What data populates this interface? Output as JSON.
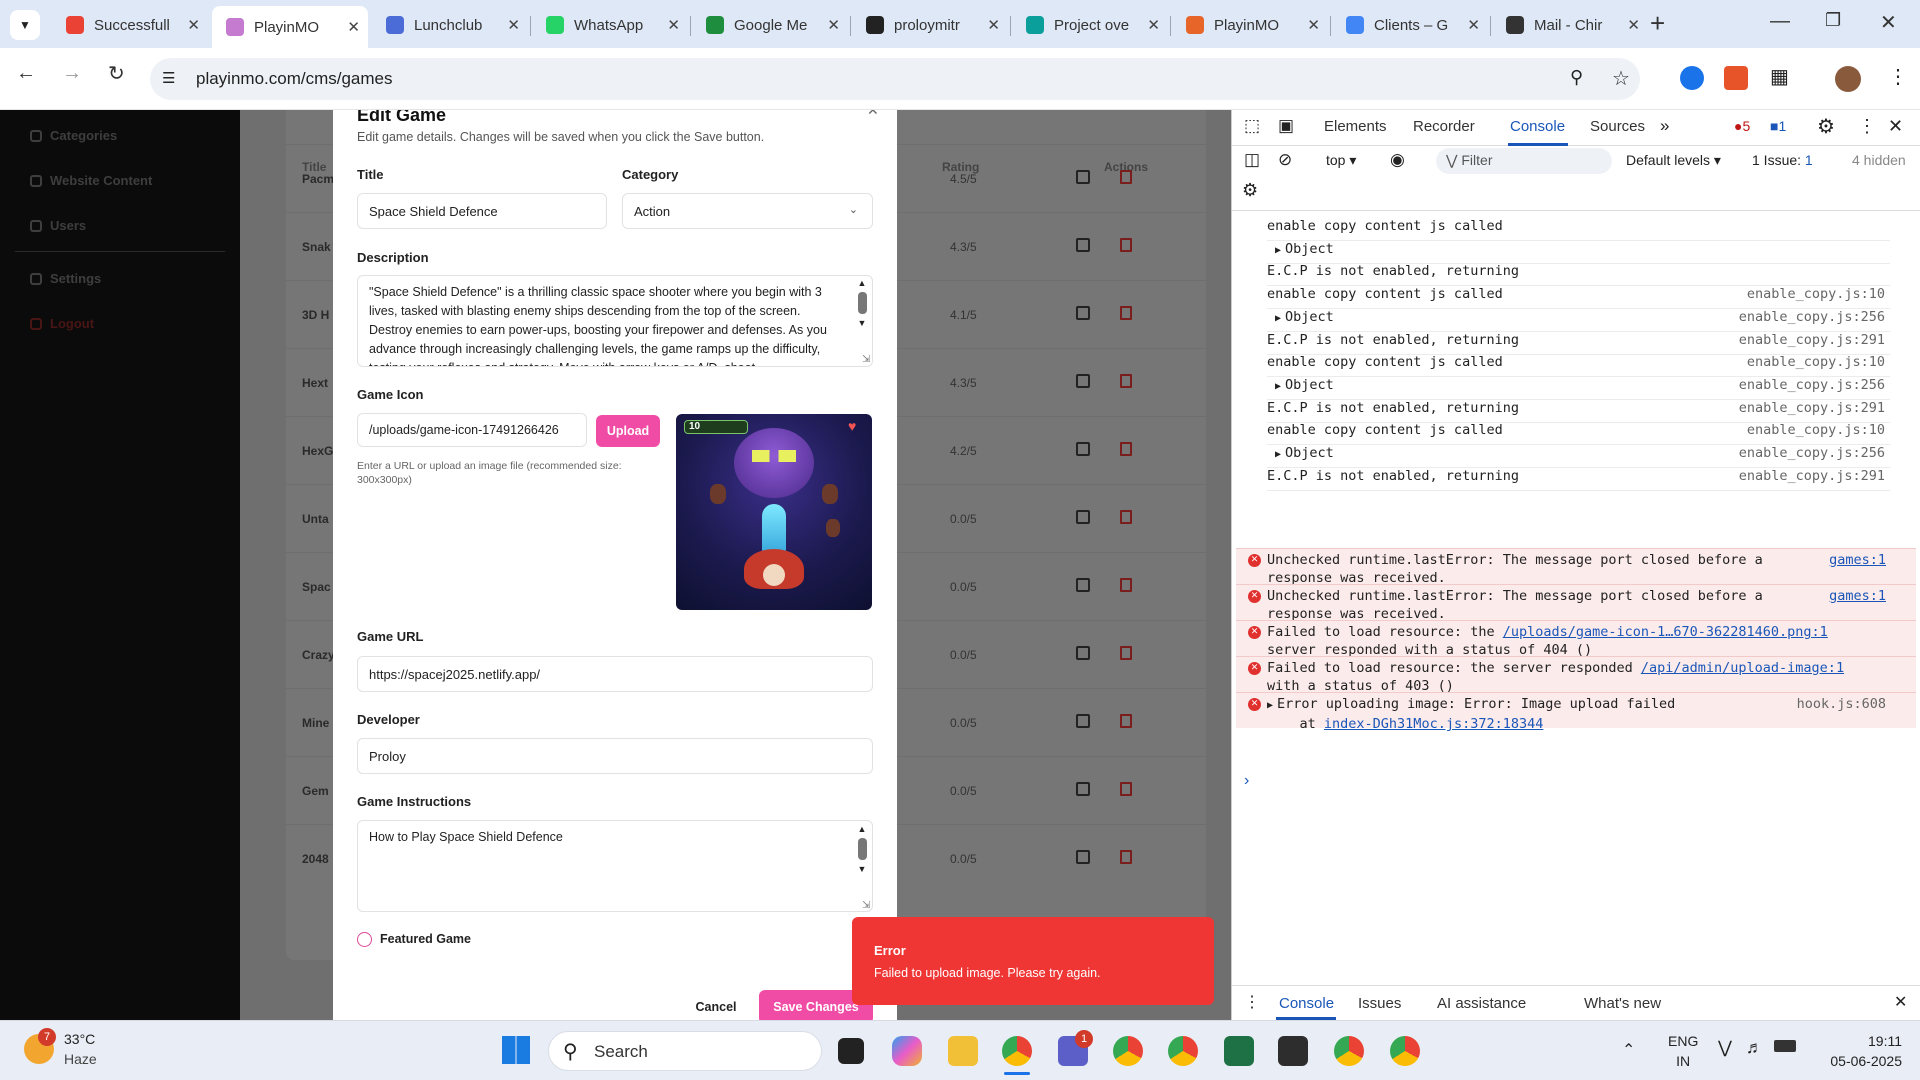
{
  "browser": {
    "tabs": [
      {
        "title": "Successfull",
        "color": "#ea4335"
      },
      {
        "title": "PlayinMO",
        "color": "#c47bd0",
        "active": true
      },
      {
        "title": "Lunchclub",
        "color": "#4b6bd6"
      },
      {
        "title": "WhatsApp",
        "color": "#25d366"
      },
      {
        "title": "Google Me",
        "color": "#1e8e3e"
      },
      {
        "title": "proloymitr",
        "color": "#222222"
      },
      {
        "title": "Project ove",
        "color": "#0a9f9a"
      },
      {
        "title": "PlayinMO",
        "color": "#e8652a"
      },
      {
        "title": "Clients – G",
        "color": "#4285f4"
      },
      {
        "title": "Mail - Chir",
        "color": "#333333"
      }
    ],
    "url": "playinmo.com/cms/games"
  },
  "sidebar": {
    "items": [
      {
        "label": "Categories"
      },
      {
        "label": "Website Content"
      },
      {
        "label": "Users"
      },
      {
        "label": "Settings"
      },
      {
        "label": "Logout"
      }
    ]
  },
  "table": {
    "headers": {
      "title": "Title",
      "rating": "Rating",
      "actions": "Actions"
    },
    "rows": [
      {
        "name": "Pacm",
        "rating": "4.5/5"
      },
      {
        "name": "Snak",
        "rating": "4.3/5"
      },
      {
        "name": "3D H",
        "rating": "4.1/5"
      },
      {
        "name": "Hext",
        "rating": "4.3/5"
      },
      {
        "name": "HexG",
        "rating": "4.2/5"
      },
      {
        "name": "Unta",
        "rating": "0.0/5"
      },
      {
        "name": "Spac",
        "rating": "0.0/5"
      },
      {
        "name": "Crazy",
        "rating": "0.0/5"
      },
      {
        "name": "Mine",
        "rating": "0.0/5"
      },
      {
        "name": "Gem",
        "rating": "0.0/5"
      },
      {
        "name": "2048",
        "rating": "0.0/5"
      }
    ]
  },
  "modal": {
    "title": "Edit Game",
    "subtitle": "Edit game details. Changes will be saved when you click the Save button.",
    "title_label": "Title",
    "title_value": "Space Shield Defence",
    "category_label": "Category",
    "category_value": "Action",
    "description_label": "Description",
    "description_value": "\"Space Shield Defence\" is a thrilling classic space shooter where you begin with 3 lives, tasked with blasting enemy ships descending from the top of the screen. Destroy enemies to earn power-ups, boosting your firepower and defenses. As you advance through increasingly challenging levels, the game ramps up the difficulty, testing your reflexes and strategy. Move with arrow keys or A/D, shoot",
    "icon_label": "Game Icon",
    "icon_value": "/uploads/game-icon-17491266426",
    "upload_label": "Upload",
    "icon_hint": "Enter a URL or upload an image file (recommended size: 300x300px)",
    "preview_score": "10",
    "url_label": "Game URL",
    "url_value": "https://spacej2025.netlify.app/",
    "developer_label": "Developer",
    "developer_value": "Proloy",
    "instructions_label": "Game Instructions",
    "instructions_value": "How to Play Space Shield Defence",
    "featured_label": "Featured Game",
    "cancel_label": "Cancel",
    "save_label": "Save Changes"
  },
  "toast": {
    "title": "Error",
    "message": "Failed to upload image. Please try again."
  },
  "devtools": {
    "tabs": [
      "Elements",
      "Recorder",
      "Console",
      "Sources"
    ],
    "active_tab": "Console",
    "error_count": "5",
    "message_count": "1",
    "context": "top",
    "filter_placeholder": "Filter",
    "levels": "Default levels",
    "issues": "1 Issue:",
    "issues_count": "1",
    "hidden": "4 hidden",
    "log": [
      {
        "text": "enable copy content js called",
        "src": ""
      },
      {
        "text": "Object",
        "src": "",
        "object": true
      },
      {
        "text": "E.C.P is not enabled, returning",
        "src": ""
      },
      {
        "text": "enable copy content js called",
        "src": "enable_copy.js:10"
      },
      {
        "text": "Object",
        "src": "enable_copy.js:256",
        "object": true
      },
      {
        "text": "E.C.P is not enabled, returning",
        "src": "enable_copy.js:291"
      },
      {
        "text": "enable copy content js called",
        "src": "enable_copy.js:10"
      },
      {
        "text": "Object",
        "src": "enable_copy.js:256",
        "object": true
      },
      {
        "text": "E.C.P is not enabled, returning",
        "src": "enable_copy.js:291"
      },
      {
        "text": "enable copy content js called",
        "src": "enable_copy.js:10"
      },
      {
        "text": "Object",
        "src": "enable_copy.js:256",
        "object": true
      },
      {
        "text": "E.C.P is not enabled, returning",
        "src": "enable_copy.js:291"
      }
    ],
    "errors": [
      {
        "line1": "Unchecked runtime.lastError: The message port closed before a",
        "line2": "response was received.",
        "src": "games:1"
      },
      {
        "line1": "Unchecked runtime.lastError: The message port closed before a",
        "line2": "response was received.",
        "src": "games:1"
      },
      {
        "line1a": "Failed to load resource: the ",
        "link": "/uploads/game-icon-1…670-362281460.png:1",
        "line2": "server responded with a status of 404 ()"
      },
      {
        "line1a": "Failed to load resource: the server responded ",
        "link": "/api/admin/upload-image:1",
        "line2": "with a status of 403 ()"
      },
      {
        "line1": "Error uploading image: Error: Image upload failed",
        "line2a": "    at ",
        "link2": "index-DGh31Moc.js:372:18344",
        "src": "hook.js:608"
      }
    ],
    "drawer_tabs": [
      "Console",
      "Issues",
      "AI assistance",
      "What's new"
    ]
  },
  "taskbar": {
    "weather_temp": "33°C",
    "weather_desc": "Haze",
    "weather_badge": "7",
    "search_label": "Search",
    "lang1": "ENG",
    "lang2": "IN",
    "time": "19:11",
    "date": "05-06-2025",
    "teams_badge": "1"
  }
}
